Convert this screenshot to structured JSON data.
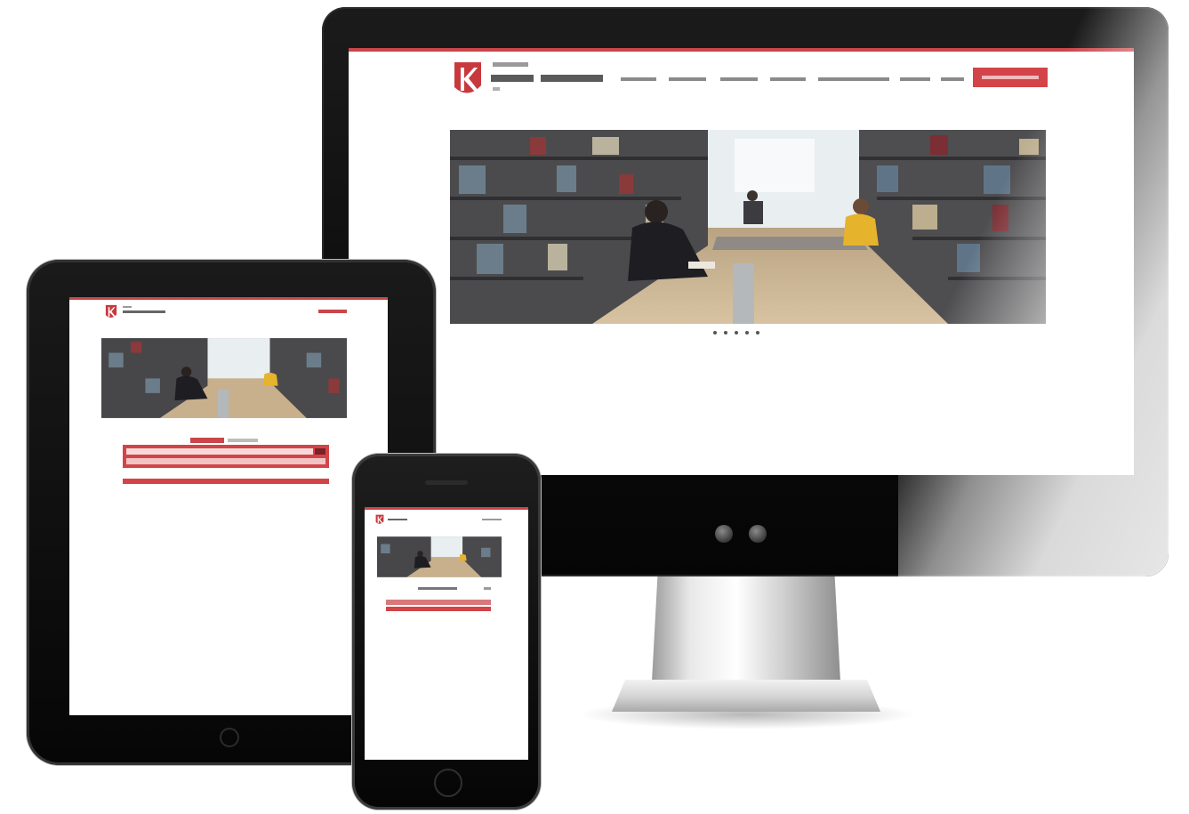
{
  "site": {
    "brand_name": "",
    "accent_color": "#d24448",
    "topline_color": "#c9464a",
    "logo_icon": "library-logo-icon"
  },
  "desktop": {
    "nav_item_count": 7,
    "cta_color": "#d24448",
    "hero_icon": "library-photo",
    "slider_dots": 5
  },
  "tablet": {
    "hero_icon": "library-photo",
    "search_form_color": "#d24448"
  },
  "phone": {
    "hero_icon": "library-photo",
    "search_form_color": "#d24448"
  }
}
